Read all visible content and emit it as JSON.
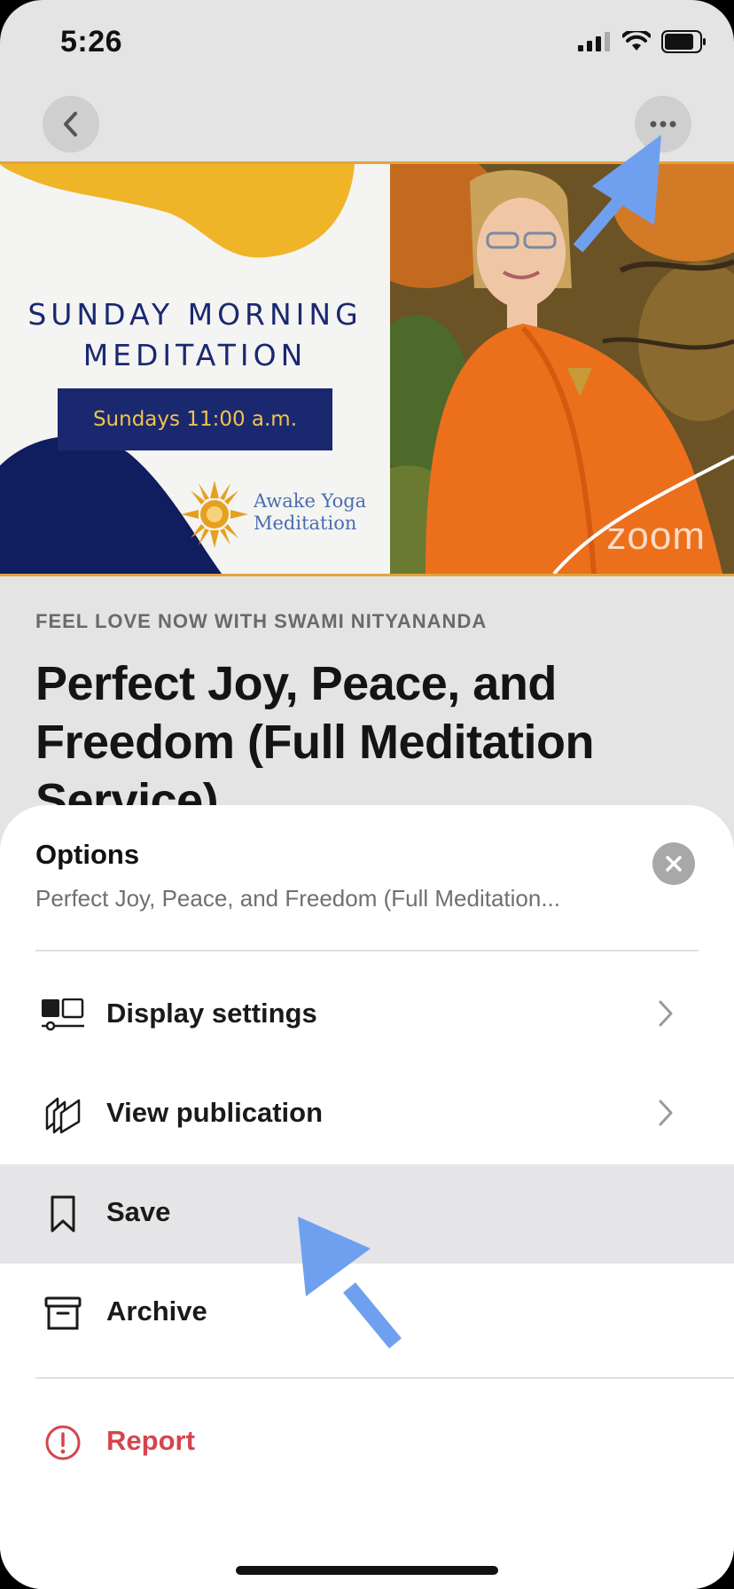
{
  "status_bar": {
    "time": "5:26",
    "signal_icon": "cellular-signal-icon",
    "wifi_icon": "wifi-icon",
    "battery_icon": "battery-icon"
  },
  "top_nav": {
    "back_icon": "chevron-left-icon",
    "more_icon": "ellipsis-icon"
  },
  "hero": {
    "banner_line1": "SUNDAY MORNING",
    "banner_line2": "MEDITATION",
    "schedule": "Sundays 11:00 a.m.",
    "brand_line1": "Awake Yoga",
    "brand_line2": "Meditation",
    "zoom_mark": "zoom"
  },
  "post": {
    "publication": "FEEL LOVE NOW WITH SWAMI NITYANANDA",
    "title": "Perfect Joy, Peace, and Freedom (Full Meditation Service)"
  },
  "sheet": {
    "title": "Options",
    "subtitle": "Perfect Joy, Peace, and Freedom (Full Meditation...",
    "close_icon": "close-icon",
    "items": [
      {
        "label": "Display settings",
        "icon": "display-settings-icon",
        "has_chevron": true
      },
      {
        "label": "View publication",
        "icon": "publication-icon",
        "has_chevron": true
      },
      {
        "label": "Save",
        "icon": "bookmark-icon",
        "highlighted": true
      },
      {
        "label": "Archive",
        "icon": "archive-icon"
      },
      {
        "label": "Report",
        "icon": "report-icon",
        "danger": true
      }
    ]
  },
  "colors": {
    "accent_arrow": "#6fa0f0",
    "danger": "#d7444d",
    "banner_navy": "#1a2870",
    "banner_gold": "#f0b428"
  }
}
